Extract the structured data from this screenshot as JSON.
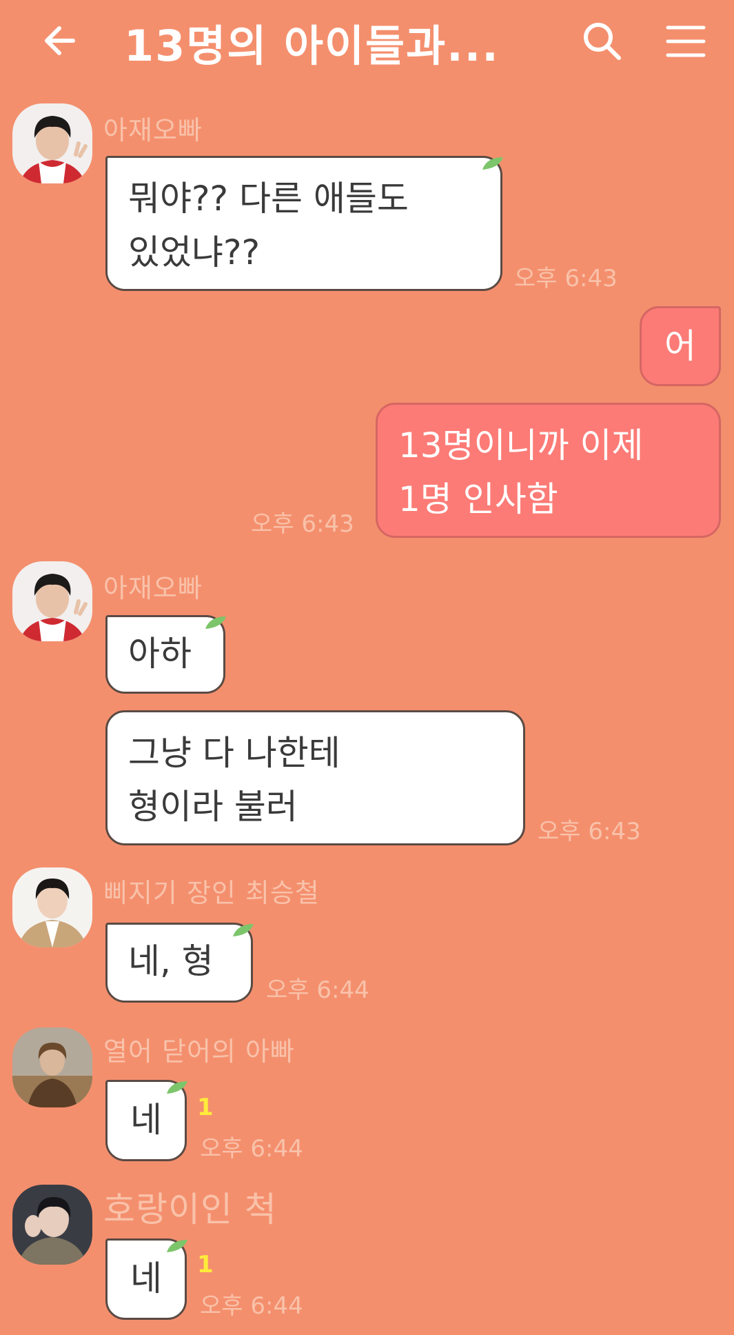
{
  "header": {
    "title": "13명의 아이들과...",
    "back_icon": "back-arrow-icon",
    "search_icon": "search-icon",
    "menu_icon": "hamburger-menu-icon"
  },
  "colors": {
    "background": "#F48F6D",
    "my_bubble": "#FC7B76",
    "other_bubble": "#FFFFFF",
    "sender_name": "#F9C2AA",
    "unread": "#FFEB3B"
  },
  "messages": [
    {
      "sender": "아재오빠",
      "text_lines": [
        "뭐야?? 다른 애들도",
        "있었냐??"
      ],
      "time": "오후 6:43"
    },
    {
      "sender": "me",
      "text_lines": [
        "어"
      ]
    },
    {
      "sender": "me",
      "text_lines": [
        "13명이니까 이제",
        "1명 인사함"
      ],
      "time": "오후 6:43"
    },
    {
      "sender": "아재오빠",
      "text_lines": [
        "아하"
      ]
    },
    {
      "sender": "아재오빠",
      "text_lines": [
        "그냥 다 나한테",
        "형이라 불러"
      ],
      "time": "오후 6:43"
    },
    {
      "sender": "삐지기 장인 최승철",
      "text_lines": [
        "네, 형"
      ],
      "time": "오후 6:44"
    },
    {
      "sender": "열어 닫어의 아빠",
      "text_lines": [
        "네"
      ],
      "unread": "1",
      "time": "오후 6:44"
    },
    {
      "sender": "호랑이인 척",
      "text_lines": [
        "네"
      ],
      "unread": "1",
      "time": "오후 6:44"
    }
  ]
}
